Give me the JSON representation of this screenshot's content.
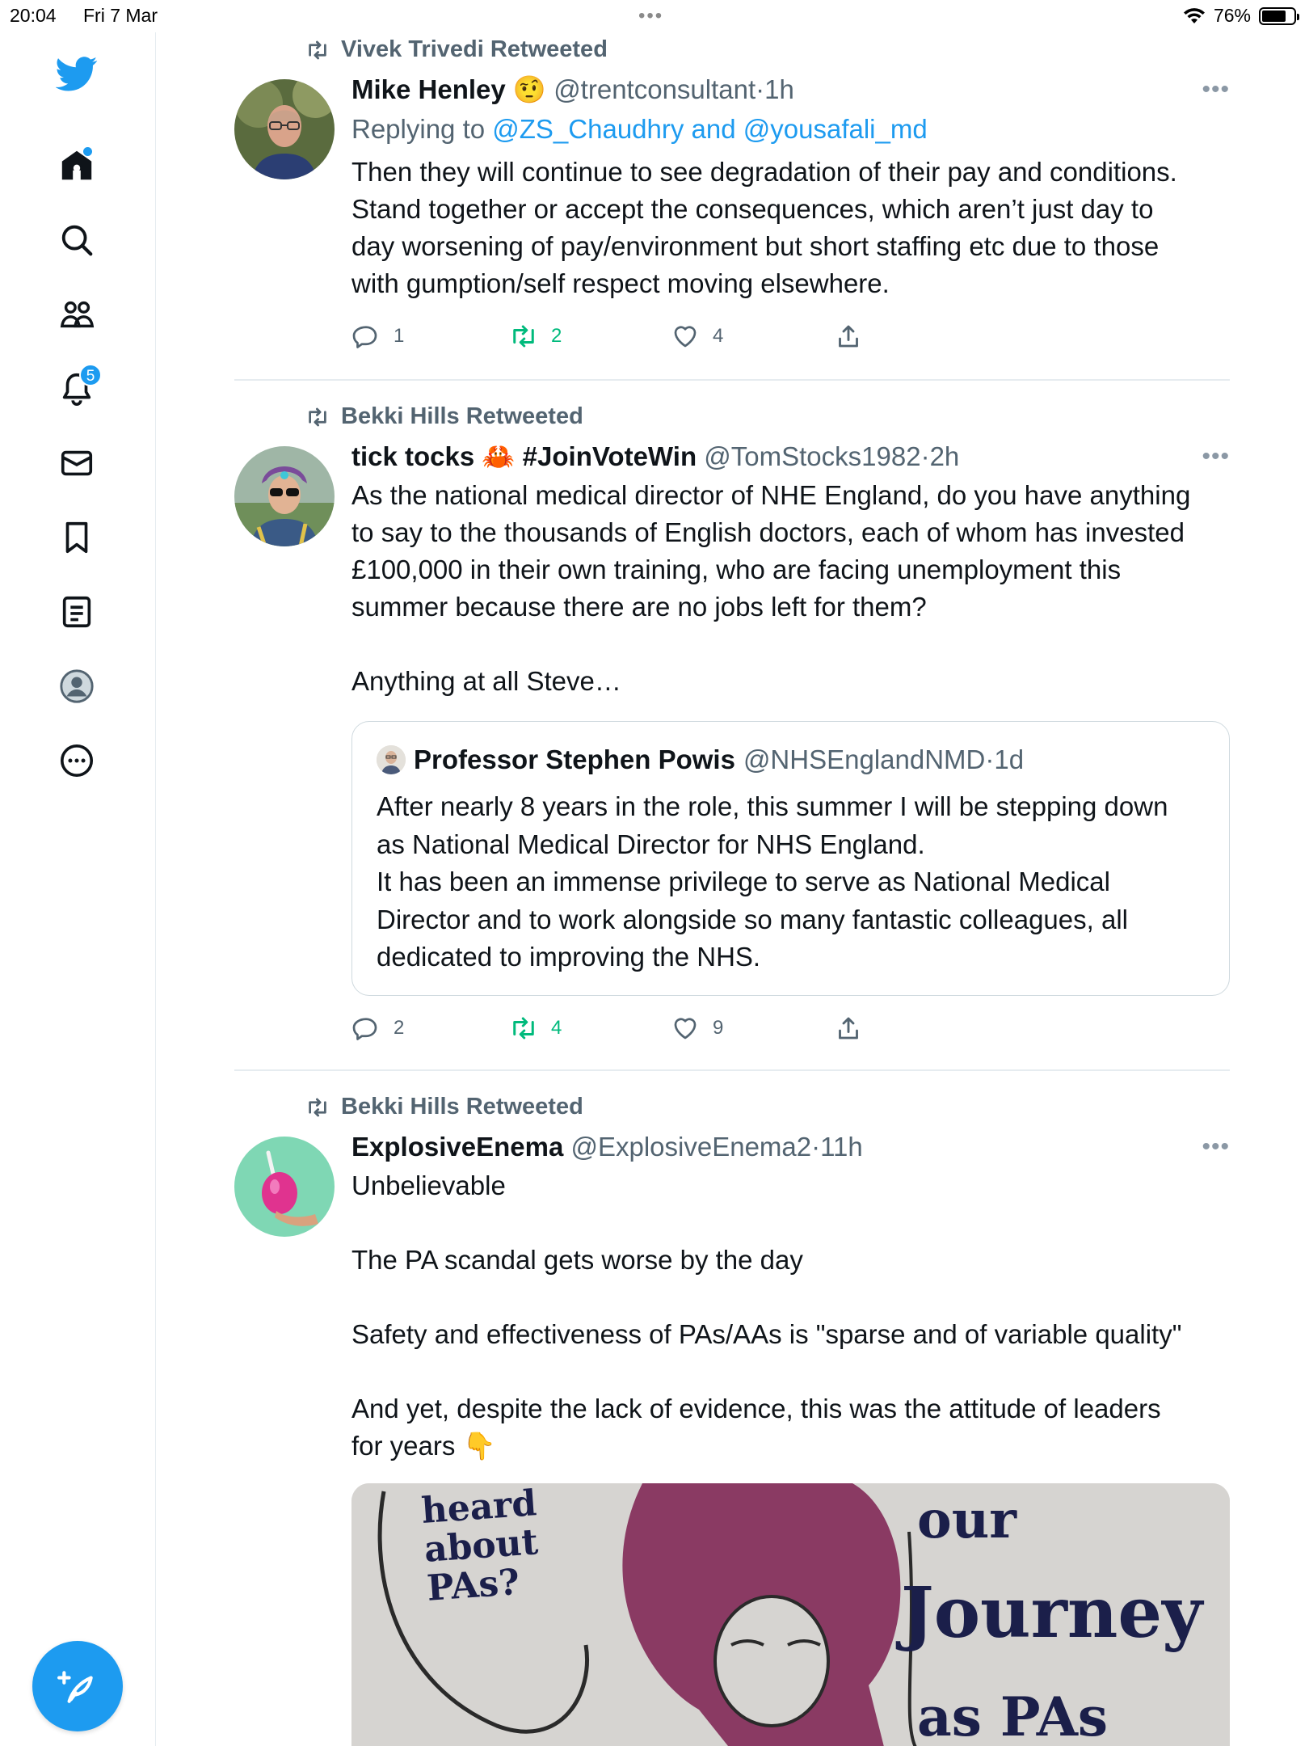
{
  "status_bar": {
    "time": "20:04",
    "date": "Fri 7 Mar",
    "dots": "•••",
    "battery": "76%",
    "battery_level": 0.76
  },
  "sidebar": {
    "items": [
      {
        "name": "logo",
        "icon": "twitter-bird-icon"
      },
      {
        "name": "home",
        "icon": "home-icon"
      },
      {
        "name": "explore",
        "icon": "search-icon"
      },
      {
        "name": "communities",
        "icon": "people-icon"
      },
      {
        "name": "notifications",
        "icon": "bell-icon",
        "badge": "5"
      },
      {
        "name": "messages",
        "icon": "mail-icon"
      },
      {
        "name": "bookmarks",
        "icon": "bookmark-icon"
      },
      {
        "name": "lists",
        "icon": "list-icon"
      },
      {
        "name": "profile",
        "icon": "profile-icon"
      },
      {
        "name": "more",
        "icon": "more-circle-icon"
      }
    ],
    "compose_icon": "compose-feather-icon"
  },
  "tweets": [
    {
      "retweeted_by": "Vivek Trivedi Retweeted",
      "name": "Mike Henley",
      "name_emoji": "🤨",
      "handle": "@trentconsultant",
      "sep": "·",
      "time": "1h",
      "replying_prefix": "Replying to ",
      "replying_to": "@ZS_Chaudhry and @yousafali_md",
      "body": "Then they will continue to see degradation of their pay and conditions.\nStand together or accept the consequences, which aren’t just day to\nday worsening of pay/environment but short staffing etc due to those\nwith gumption/self respect moving elsewhere.",
      "replies": "1",
      "retweets": "2",
      "likes": "4"
    },
    {
      "retweeted_by": "Bekki Hills Retweeted",
      "name": "tick tocks 🦀 #JoinVoteWin",
      "handle": "@TomStocks1982",
      "sep": "·",
      "time": "2h",
      "body": "As the national medical director of NHE England, do you have anything\nto say to the thousands of English doctors, each of whom has invested\n£100,000 in their own training, who are facing unemployment this\nsummer because there are no jobs left for them?\n\nAnything at all Steve…",
      "quote": {
        "name": "Professor Stephen Powis",
        "handle": "@NHSEnglandNMD",
        "sep": "·",
        "time": "1d",
        "body": "After nearly 8 years in the role, this summer I will be stepping down\nas National Medical Director for NHS England.\nIt has been an immense privilege to serve as National Medical\nDirector and to work alongside so many fantastic colleagues, all\ndedicated to improving the NHS."
      },
      "replies": "2",
      "retweets": "4",
      "likes": "9"
    },
    {
      "retweeted_by": "Bekki Hills Retweeted",
      "name": "ExplosiveEnema",
      "handle": "@ExplosiveEnema2",
      "sep": "·",
      "time": "11h",
      "body": "Unbelievable\n\nThe PA scandal gets worse by the day\n\nSafety and effectiveness of PAs/AAs is \"sparse and of variable quality\"\n\nAnd yet, despite the lack of evidence, this was the attitude of leaders\nfor years 👇",
      "media_text": {
        "left": "heard\nabout\nPAs?",
        "right_top": "our",
        "right_mid": "Journey",
        "right_bottom": "as PAs"
      }
    }
  ],
  "more_glyph": "•••",
  "colors": {
    "accent": "#1d9bf0",
    "retweet": "#00ba7c",
    "secondary": "#536471",
    "border": "#e6ecf0"
  }
}
